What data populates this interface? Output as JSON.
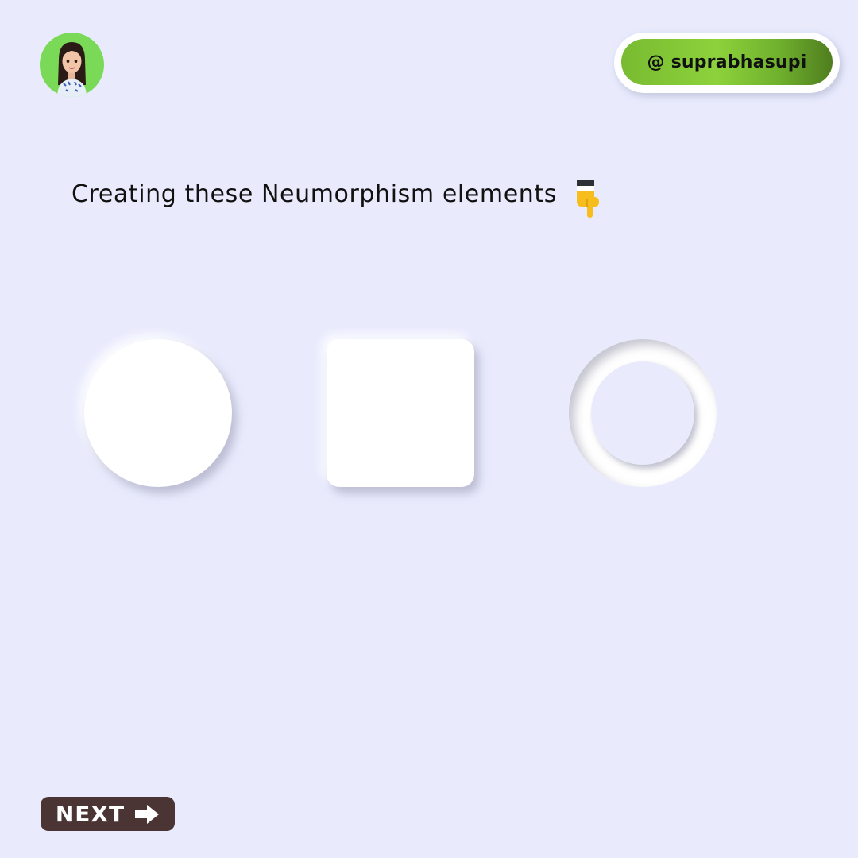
{
  "header": {
    "avatar_icon": "avatar-icon",
    "handle": "@ suprabhasupi"
  },
  "main": {
    "headline": "Creating these Neumorphism elements",
    "headline_icon": "pointing-down-hand-icon",
    "shapes": [
      "neumorphic-circle",
      "neumorphic-square",
      "neumorphic-ring"
    ]
  },
  "footer": {
    "next_label": "NEXT",
    "next_icon": "right-arrow-icon"
  },
  "colors": {
    "background": "#e9ebfd",
    "avatar_bg": "#7ad957",
    "handle_green": "#78bb31",
    "next_bg": "#4a3434"
  }
}
